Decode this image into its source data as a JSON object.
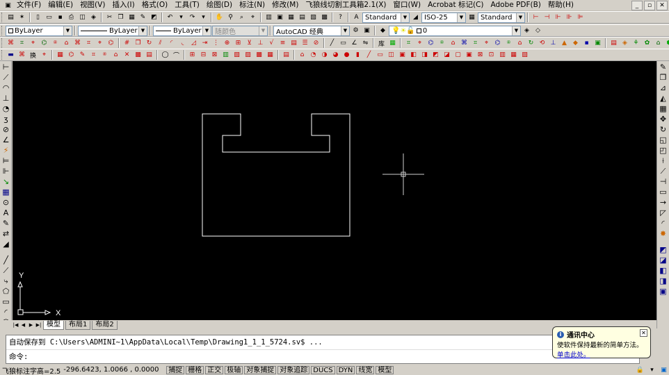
{
  "menu": [
    "文件(F)",
    "编辑(E)",
    "视图(V)",
    "插入(I)",
    "格式(O)",
    "工具(T)",
    "绘图(D)",
    "标注(N)",
    "修改(M)",
    "飞狼线切割工具箱2.1(X)",
    "窗口(W)",
    "Acrobat 标记(C)",
    "Adobe PDF(B)",
    "帮助(H)"
  ],
  "toolbar_std": {
    "text_style": "Standard",
    "dim_style": "ISO-25",
    "table_style": "Standard"
  },
  "props": {
    "color": "ByLayer",
    "linetype": "ByLayer",
    "lineweight": "ByLayer",
    "plotstyle": "随颜色",
    "workspace": "AutoCAD 经典",
    "layer": "0"
  },
  "toolbar3_labels": {
    "convert": "换",
    "library": "库"
  },
  "ucs": {
    "y": "Y",
    "x": "X"
  },
  "tabs": [
    "模型",
    "布局1",
    "布局2"
  ],
  "command": {
    "history": "自动保存到 C:\\Users\\ADMINI~1\\AppData\\Local\\Temp\\Drawing1_1_1_5724.sv$ ...",
    "prompt": "命令:"
  },
  "status": {
    "left": "飞狼标注字高=2.5",
    "coords": "-296.6423, 1.0066   , 0.0000",
    "toggles": [
      "捕捉",
      "栅格",
      "正交",
      "极轴",
      "对象捕捉",
      "对象追踪",
      "DUCS",
      "DYN",
      "线宽",
      "模型"
    ]
  },
  "notify": {
    "title": "通讯中心",
    "body": "使软件保持最新的简单方法。",
    "link": "单击此处。"
  },
  "colors": {
    "canvas": "#000000",
    "lines": "#ffffff",
    "ui": "#d4d0c8"
  }
}
